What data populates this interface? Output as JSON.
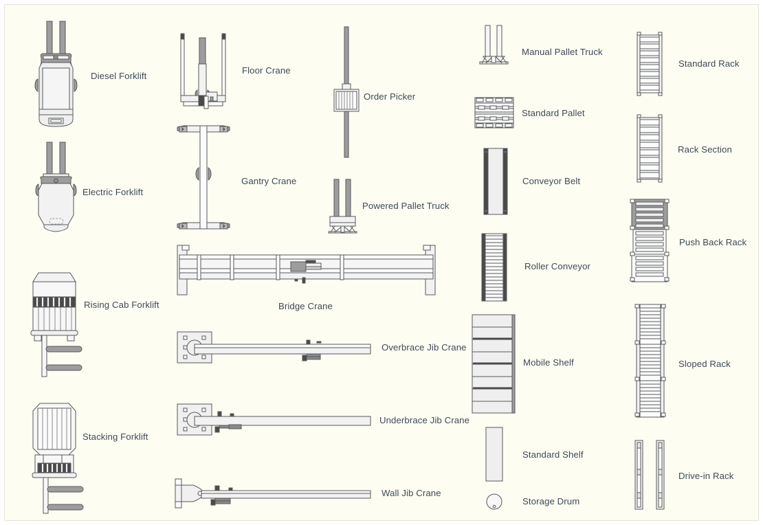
{
  "page": {
    "background_color": "#fdfdf2",
    "border_color": "#e4e4dc",
    "label_color": "#3e4a56",
    "stroke_color": "#57585a",
    "fill_light": "#f0f0f0",
    "fill_mid": "#a8a8a8",
    "fill_dark": "#4a4a4a"
  },
  "columns": [
    {
      "name": "forklifts",
      "items": [
        {
          "id": "diesel-forklift",
          "label": "Diesel Forklift"
        },
        {
          "id": "electric-forklift",
          "label": "Electric Forklift"
        },
        {
          "id": "rising-cab-forklift",
          "label": "Rising Cab Forklift"
        },
        {
          "id": "stacking-forklift",
          "label": "Stacking Forklift"
        }
      ]
    },
    {
      "name": "cranes",
      "items": [
        {
          "id": "floor-crane",
          "label": "Floor Crane"
        },
        {
          "id": "gantry-crane",
          "label": "Gantry Crane"
        },
        {
          "id": "bridge-crane",
          "label": "Bridge Crane"
        },
        {
          "id": "overbrace-jib-crane",
          "label": "Overbrace Jib Crane"
        },
        {
          "id": "underbrace-jib-crane",
          "label": "Underbrace Jib Crane"
        },
        {
          "id": "wall-jib-crane",
          "label": "Wall Jib Crane"
        }
      ]
    },
    {
      "name": "pickers",
      "items": [
        {
          "id": "order-picker",
          "label": "Order Picker"
        },
        {
          "id": "powered-pallet-truck",
          "label": "Powered Pallet Truck"
        }
      ]
    },
    {
      "name": "handling",
      "items": [
        {
          "id": "manual-pallet-truck",
          "label": "Manual Pallet Truck"
        },
        {
          "id": "standard-pallet",
          "label": "Standard Pallet"
        },
        {
          "id": "conveyor-belt",
          "label": "Conveyor Belt"
        },
        {
          "id": "roller-conveyor",
          "label": "Roller Conveyor"
        },
        {
          "id": "mobile-shelf",
          "label": "Mobile Shelf"
        },
        {
          "id": "standard-shelf",
          "label": "Standard Shelf"
        },
        {
          "id": "storage-drum",
          "label": "Storage Drum"
        }
      ]
    },
    {
      "name": "racks",
      "items": [
        {
          "id": "standard-rack",
          "label": "Standard Rack"
        },
        {
          "id": "rack-section",
          "label": "Rack Section"
        },
        {
          "id": "push-back-rack",
          "label": "Push Back Rack"
        },
        {
          "id": "sloped-rack",
          "label": "Sloped Rack"
        },
        {
          "id": "drive-in-rack",
          "label": "Drive-in Rack"
        }
      ]
    }
  ]
}
